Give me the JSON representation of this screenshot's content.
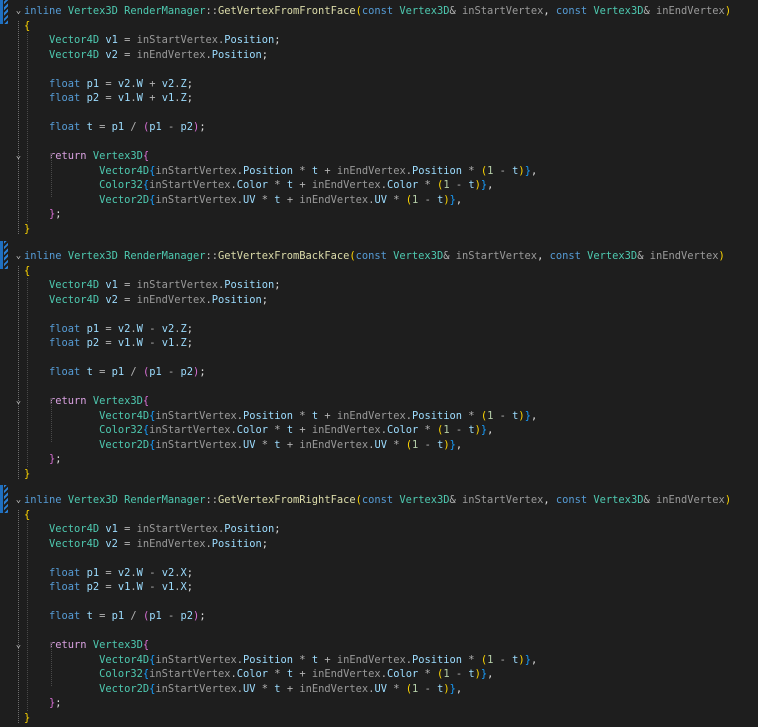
{
  "colors": {
    "keyword": "#569cd6",
    "control": "#d8a0df",
    "type": "#4ec9b0",
    "function": "#dcdcaa",
    "parameter": "#9a9a9a",
    "field": "#9cdcfe",
    "number": "#b5cea8",
    "background": "#1e1e1e",
    "change_marker": "#1f6fbf"
  },
  "icons": {
    "fold_expanded": "chevron-down-icon"
  },
  "tokens": {
    "inline": "inline",
    "Vertex3D": "Vertex3D",
    "RenderManager": "RenderManager",
    "scope": "::",
    "const": "const",
    "amp": "&",
    "inStartVertex": "inStartVertex",
    "inEndVertex": "inEndVertex",
    "comma": ",",
    "lparen": "(",
    "rparen": ")",
    "lbrace": "{",
    "rbrace": "}",
    "semi": ";",
    "Vector4D": "Vector4D",
    "Color32": "Color32",
    "Vector2D": "Vector2D",
    "v1": "v1",
    "v2": "v2",
    "p1": "p1",
    "p2": "p2",
    "t": "t",
    "float": "float",
    "return": "return",
    "Position": "Position",
    "Color": "Color",
    "UV": "UV",
    "W": "W",
    "Z": "Z",
    "X": "X",
    "dot": ".",
    "eq": "=",
    "plus": "+",
    "minus": "-",
    "star": "*",
    "slash": "/",
    "one": "1",
    "close_return": "};"
  },
  "functions": [
    {
      "name": "GetVertexFromFrontFace",
      "p1_op": "+",
      "p1_comp": "Z",
      "p2_op": "+",
      "p2_comp": "Z"
    },
    {
      "name": "GetVertexFromBackFace",
      "p1_op": "-",
      "p1_comp": "Z",
      "p2_op": "-",
      "p2_comp": "Z"
    },
    {
      "name": "GetVertexFromRightFace",
      "p1_op": "-",
      "p1_comp": "X",
      "p2_op": "-",
      "p2_comp": "X"
    }
  ]
}
